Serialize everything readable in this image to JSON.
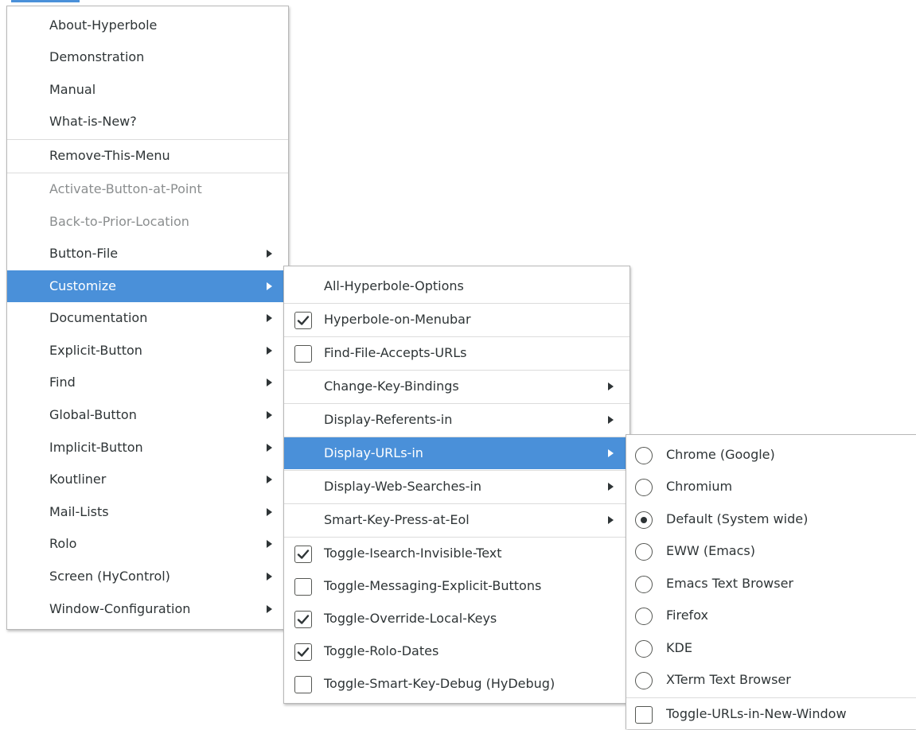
{
  "menu1": {
    "items": [
      {
        "label": "About-Hyperbole"
      },
      {
        "label": "Demonstration"
      },
      {
        "label": "Manual"
      },
      {
        "label": "What-is-New?"
      },
      {
        "label": "Remove-This-Menu"
      },
      {
        "label": "Activate-Button-at-Point"
      },
      {
        "label": "Back-to-Prior-Location"
      },
      {
        "label": "Button-File"
      },
      {
        "label": "Customize"
      },
      {
        "label": "Documentation"
      },
      {
        "label": "Explicit-Button"
      },
      {
        "label": "Find"
      },
      {
        "label": "Global-Button"
      },
      {
        "label": "Implicit-Button"
      },
      {
        "label": "Koutliner"
      },
      {
        "label": "Mail-Lists"
      },
      {
        "label": "Rolo"
      },
      {
        "label": "Screen (HyControl)"
      },
      {
        "label": "Window-Configuration"
      }
    ]
  },
  "menu2": {
    "items": [
      {
        "label": "All-Hyperbole-Options"
      },
      {
        "label": "Hyperbole-on-Menubar",
        "checked": true
      },
      {
        "label": "Find-File-Accepts-URLs",
        "checked": false
      },
      {
        "label": "Change-Key-Bindings"
      },
      {
        "label": "Display-Referents-in"
      },
      {
        "label": "Display-URLs-in"
      },
      {
        "label": "Display-Web-Searches-in"
      },
      {
        "label": "Smart-Key-Press-at-Eol"
      },
      {
        "label": "Toggle-Isearch-Invisible-Text",
        "checked": true
      },
      {
        "label": "Toggle-Messaging-Explicit-Buttons",
        "checked": false
      },
      {
        "label": "Toggle-Override-Local-Keys",
        "checked": true
      },
      {
        "label": "Toggle-Rolo-Dates",
        "checked": true
      },
      {
        "label": "Toggle-Smart-Key-Debug (HyDebug)",
        "checked": false
      }
    ]
  },
  "menu3": {
    "items": [
      {
        "label": "Chrome (Google)",
        "selected": false
      },
      {
        "label": "Chromium",
        "selected": false
      },
      {
        "label": "Default (System wide)",
        "selected": true
      },
      {
        "label": "EWW (Emacs)",
        "selected": false
      },
      {
        "label": "Emacs Text Browser",
        "selected": false
      },
      {
        "label": "Firefox",
        "selected": false
      },
      {
        "label": "KDE",
        "selected": false
      },
      {
        "label": "XTerm Text Browser",
        "selected": false
      },
      {
        "label": "Toggle-URLs-in-New-Window",
        "checked": false
      }
    ]
  },
  "colors": {
    "highlight": "#4a90d9",
    "text": "#2e3436",
    "disabled_text": "#8b8e8f"
  }
}
